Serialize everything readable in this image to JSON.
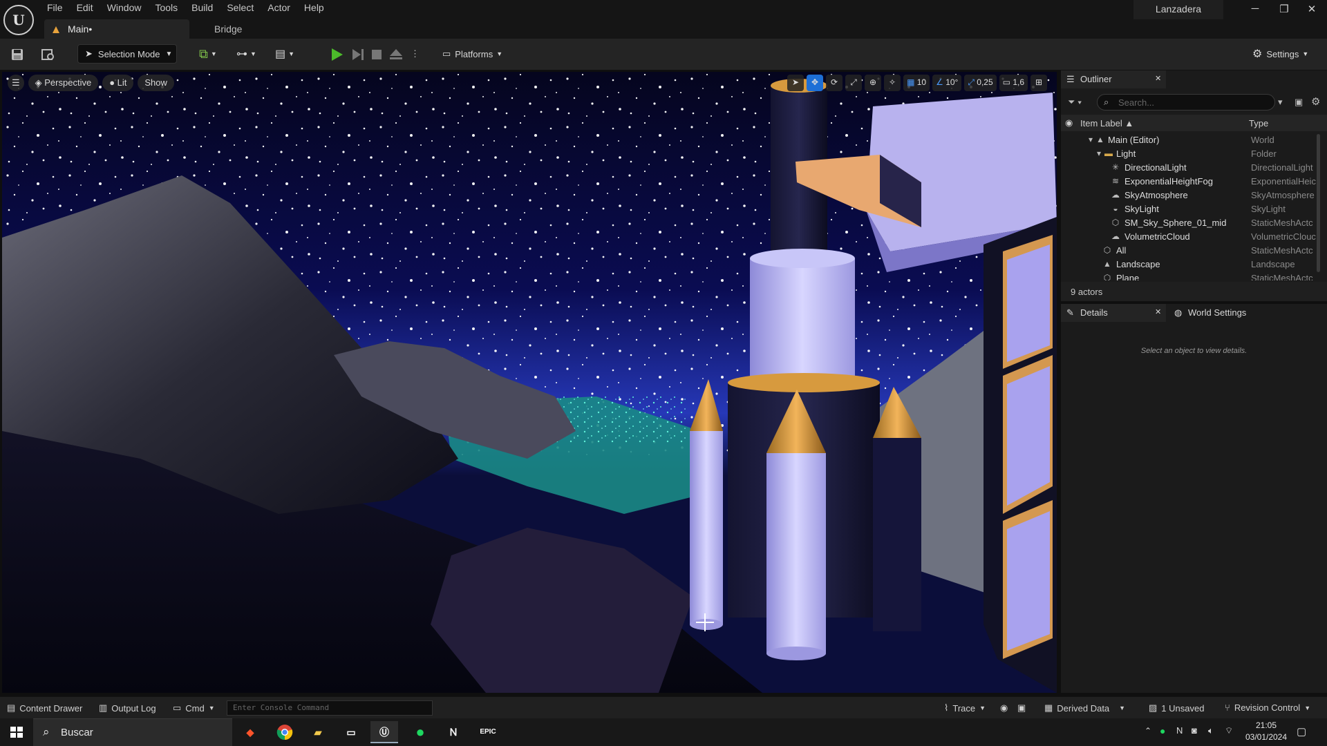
{
  "menu": [
    "File",
    "Edit",
    "Window",
    "Tools",
    "Build",
    "Select",
    "Actor",
    "Help"
  ],
  "tabs": {
    "main": "Main•",
    "bridge": "Bridge"
  },
  "project_name": "Lanzadera",
  "window_controls": {
    "minimize": "─",
    "restore": "❐",
    "close": "✕"
  },
  "toolbar": {
    "selection_mode": "Selection Mode",
    "platforms": "Platforms",
    "settings": "Settings"
  },
  "viewport": {
    "perspective": "Perspective",
    "lit": "Lit",
    "show": "Show",
    "grid_snap": "10",
    "rotation_snap": "10°",
    "scale_snap": "0,25",
    "camera_speed": "1,6"
  },
  "outliner": {
    "tab_label": "Outliner",
    "search_placeholder": "Search...",
    "col_label": "Item Label ▲",
    "col_type": "Type",
    "rows": [
      {
        "label": "Main (Editor)",
        "type": "World"
      },
      {
        "label": "Light",
        "type": "Folder"
      },
      {
        "label": "DirectionalLight",
        "type": "DirectionalLight"
      },
      {
        "label": "ExponentialHeightFog",
        "type": "ExponentialHeic"
      },
      {
        "label": "SkyAtmosphere",
        "type": "SkyAtmosphere"
      },
      {
        "label": "SkyLight",
        "type": "SkyLight"
      },
      {
        "label": "SM_Sky_Sphere_01_mid",
        "type": "StaticMeshActc"
      },
      {
        "label": "VolumetricCloud",
        "type": "VolumetricClouc"
      },
      {
        "label": "All",
        "type": "StaticMeshActc"
      },
      {
        "label": "Landscape",
        "type": "Landscape"
      },
      {
        "label": "Plane",
        "type": "StaticMeshActc"
      }
    ],
    "actor_count": "9 actors"
  },
  "details": {
    "tab_label": "Details",
    "world_settings": "World Settings",
    "empty_message": "Select an object to view details."
  },
  "statusbar": {
    "content_drawer": "Content Drawer",
    "output_log": "Output Log",
    "cmd": "Cmd",
    "console_placeholder": "Enter Console Command",
    "trace": "Trace",
    "derived_data": "Derived Data",
    "unsaved": "1 Unsaved",
    "revision_control": "Revision Control"
  },
  "taskbar": {
    "search": "Buscar",
    "time": "21:05",
    "date": "03/01/2024"
  }
}
